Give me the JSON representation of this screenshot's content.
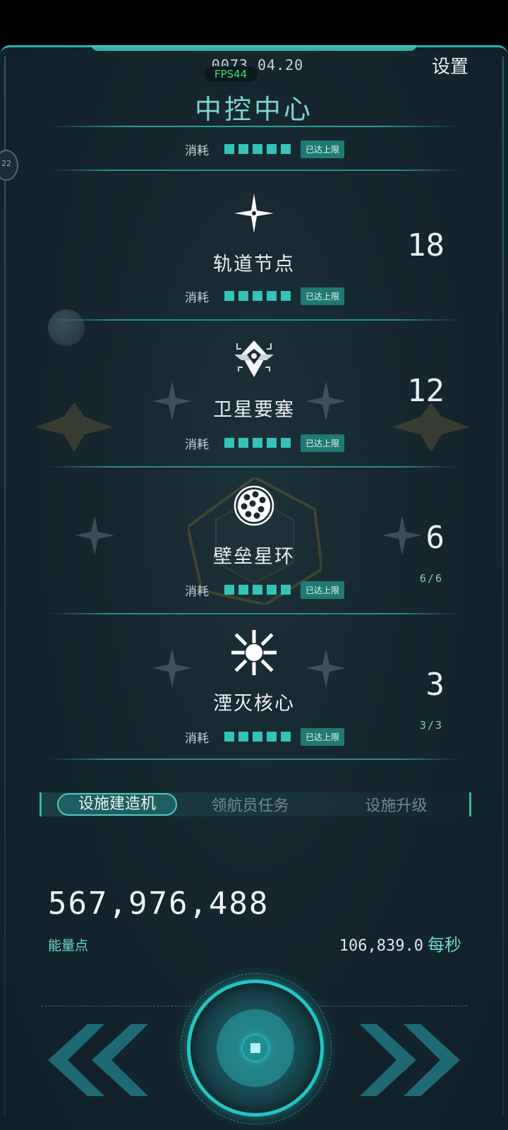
{
  "header": {
    "date": "0073.04.20",
    "fps": "FPS44",
    "settings_label": "设置",
    "title": "中控中心"
  },
  "side_tab_text": "22",
  "consume_label": "消耗",
  "max_label": "已达上限",
  "facilities": [
    {
      "name": "轨道节点",
      "count": "18",
      "cap": "",
      "icon": "four-point-star-icon",
      "consume_level": 5
    },
    {
      "name": "卫星要塞",
      "count": "12",
      "cap": "",
      "icon": "satellite-fortress-icon",
      "consume_level": 5
    },
    {
      "name": "壁垒星环",
      "count": "6",
      "cap": "6/6",
      "icon": "sphere-grid-icon",
      "consume_level": 5
    },
    {
      "name": "湮灭核心",
      "count": "3",
      "cap": "3/3",
      "icon": "burst-icon",
      "consume_level": 5
    }
  ],
  "tabs": [
    "设施建造机",
    "领航员任务",
    "设施升级"
  ],
  "energy": {
    "value": "567,976,488",
    "label": "能量点",
    "rate": "106,839.0",
    "rate_unit": "每秒"
  },
  "colors": {
    "accent": "#34c3b8",
    "title": "#7fd3d4",
    "fps": "#3ee06a",
    "cap_text": "#7fd3a6"
  }
}
